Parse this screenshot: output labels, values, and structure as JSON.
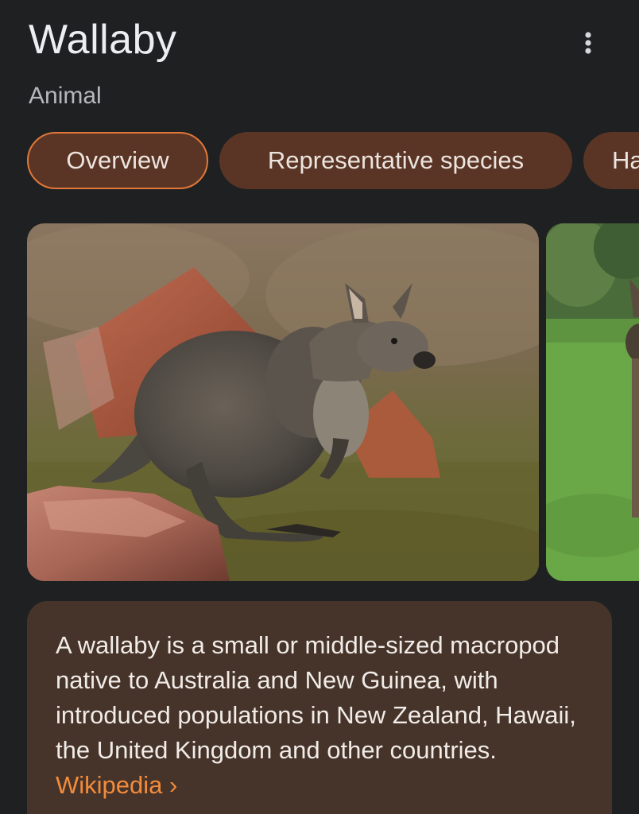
{
  "header": {
    "title": "Wallaby",
    "subtitle": "Animal",
    "more_icon": "more-vert-icon"
  },
  "tabs": [
    {
      "label": "Overview",
      "active": true
    },
    {
      "label": "Representative species",
      "active": false
    },
    {
      "label": "Ha",
      "active": false
    }
  ],
  "description": {
    "text": "A wallaby is a small or middle-sized macropod native to Australia and New Guinea, with introduced populations in New Zealand, Hawaii, the United Kingdom and other countries.",
    "source_label": "Wikipedia",
    "source_chevron": "›"
  },
  "colors": {
    "background": "#1f2022",
    "chip_fill": "#5a3526",
    "chip_active_border": "#e07838",
    "card_fill": "#46342a",
    "link": "#f28b3c"
  }
}
